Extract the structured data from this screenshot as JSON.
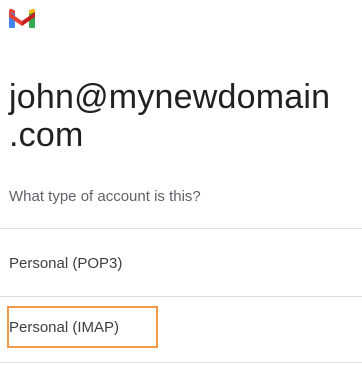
{
  "account": {
    "email": "john@mynewdomain.com"
  },
  "setup": {
    "prompt": "What type of account is this?",
    "options": [
      {
        "label": "Personal (POP3)"
      },
      {
        "label": "Personal (IMAP)",
        "highlighted": true
      }
    ]
  },
  "colors": {
    "highlight": "#ef9a4a",
    "gmail_red": "#ea4335",
    "gmail_blue": "#4285f4",
    "gmail_green": "#34a853",
    "gmail_yellow": "#fbbc04"
  },
  "icons": [
    "gmail-logo-icon"
  ]
}
